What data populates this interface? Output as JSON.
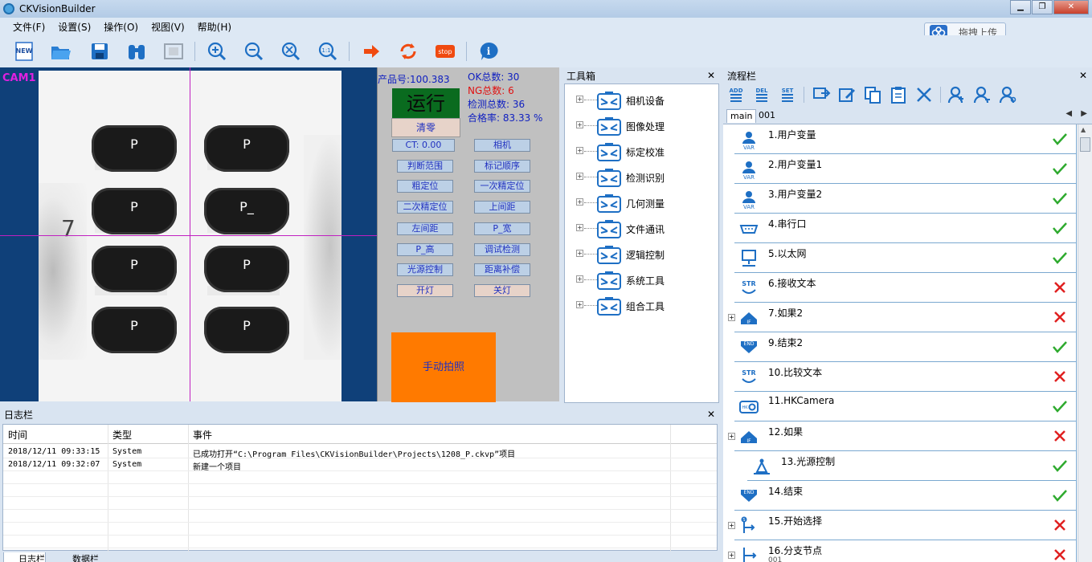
{
  "window": {
    "title": "CKVisionBuilder",
    "minimize": "▁",
    "maximize": "❐",
    "close": "✕"
  },
  "menu": [
    "文件(F)",
    "设置(S)",
    "操作(O)",
    "视图(V)",
    "帮助(H)"
  ],
  "upload_button": "拖拽上传",
  "toolbar": {
    "icons": [
      "new-file-icon",
      "open-folder-icon",
      "save-icon",
      "binoculars-icon",
      "fit-screen-icon",
      "zoom-in-icon",
      "zoom-out-icon",
      "zoom-fit-icon",
      "zoom-actual-icon",
      "run-once-icon",
      "run-loop-icon",
      "stop-icon",
      "help-icon"
    ],
    "new_label": "NEW",
    "stop_label": "stop"
  },
  "camera": {
    "label": "CAM1",
    "side_mark": "7",
    "keycaps": [
      "P",
      "P",
      "P",
      "P_",
      "P",
      "P",
      "P",
      "P"
    ]
  },
  "control": {
    "product_no": "产品号:100.383",
    "ok_total": "OK总数: 30",
    "ng_total": "NG总数: 6",
    "check_total": "检测总数: 36",
    "pass_rate": "合格率: 83.33 %",
    "run_status": "运行",
    "reset": "清零",
    "ct": "CT: 0.00",
    "buttons": [
      "相机",
      "判断范围",
      "标记顺序",
      "粗定位",
      "一次精定位",
      "二次精定位",
      "上间距",
      "左间距",
      "P_宽",
      "P_高",
      "调试检测",
      "光源控制",
      "距离补偿",
      "开灯",
      "关灯"
    ],
    "manual_photo": "手动拍照"
  },
  "toolbox": {
    "title": "工具箱",
    "close": "✕",
    "expander": "+",
    "items": [
      "相机设备",
      "图像处理",
      "标定校准",
      "检测识别",
      "几何测量",
      "文件通讯",
      "逻辑控制",
      "系统工具",
      "组合工具"
    ]
  },
  "flow": {
    "title": "流程栏",
    "close": "✕",
    "toolbar_icons": [
      "add-step-icon",
      "delete-step-icon",
      "set-step-icon",
      "export-icon",
      "edit-icon",
      "copy-icon",
      "paste-icon",
      "cut-icon",
      "user-icon",
      "user-move-icon",
      "user-search-icon"
    ],
    "toolbar_labels": [
      "ADD",
      "DEL",
      "SET"
    ],
    "tabs": [
      "main",
      "001"
    ],
    "nav_prev": "◀",
    "nav_next": "▶",
    "expander": "+",
    "items": [
      {
        "label": "1.用户变量",
        "icon": "var-icon",
        "icon_text": "VAR",
        "status": "ok",
        "indent": false,
        "expander": false
      },
      {
        "label": "2.用户变量1",
        "icon": "var-icon",
        "icon_text": "VAR",
        "status": "ok",
        "indent": false,
        "expander": false
      },
      {
        "label": "3.用户变量2",
        "icon": "var-icon",
        "icon_text": "VAR",
        "status": "ok",
        "indent": false,
        "expander": false
      },
      {
        "label": "4.串行口",
        "icon": "serial-port-icon",
        "icon_text": "",
        "status": "ok",
        "indent": false,
        "expander": false
      },
      {
        "label": "5.以太网",
        "icon": "ethernet-icon",
        "icon_text": "",
        "status": "ok",
        "indent": false,
        "expander": false
      },
      {
        "label": "6.接收文本",
        "icon": "receive-text-icon",
        "icon_text": "STR",
        "status": "fail",
        "indent": false,
        "expander": false
      },
      {
        "label": "7.如果2",
        "icon": "if-icon",
        "icon_text": "IF",
        "status": "fail",
        "indent": false,
        "expander": true
      },
      {
        "label": "9.结束2",
        "icon": "end-icon",
        "icon_text": "END",
        "status": "ok",
        "indent": false,
        "expander": false
      },
      {
        "label": "10.比较文本",
        "icon": "compare-text-icon",
        "icon_text": "STR",
        "status": "fail",
        "indent": false,
        "expander": false
      },
      {
        "label": "11.HKCamera",
        "icon": "camera-icon",
        "icon_text": "HK",
        "status": "ok",
        "indent": false,
        "expander": false
      },
      {
        "label": "12.如果",
        "icon": "if-icon",
        "icon_text": "IF",
        "status": "fail",
        "indent": false,
        "expander": true
      },
      {
        "label": "13.光源控制",
        "icon": "light-control-icon",
        "icon_text": "",
        "status": "ok",
        "indent": true,
        "expander": false
      },
      {
        "label": "14.结束",
        "icon": "end-icon",
        "icon_text": "END",
        "status": "ok",
        "indent": false,
        "expander": false
      },
      {
        "label": "15.开始选择",
        "icon": "branch-start-icon",
        "icon_text": "S",
        "status": "fail",
        "indent": false,
        "expander": true
      },
      {
        "label": "16.分支节点",
        "icon": "branch-node-icon",
        "icon_text": "",
        "status": "fail",
        "indent": false,
        "expander": true,
        "sub": "001"
      }
    ],
    "status_ok": "✔",
    "status_fail": "✕",
    "scroll_up": "▲",
    "scroll_down": "▼"
  },
  "log": {
    "title": "日志栏",
    "close": "✕",
    "columns": [
      "时间",
      "类型",
      "事件"
    ],
    "rows": [
      [
        "2018/12/11 09:33:15",
        "System",
        "已成功打开“C:\\Program Files\\CKVisionBuilder\\Projects\\1208_P.ckvp”项目"
      ],
      [
        "2018/12/11 09:32:07",
        "System",
        "新建一个项目"
      ]
    ],
    "tabs": [
      "日志栏",
      "数据栏"
    ]
  },
  "colors": {
    "camera_bg": "#0f4079",
    "crosshair": "#c020c0",
    "run_box": "#0a6b1f",
    "manual_photo": "#ff7a00",
    "ok_check": "#2eaa2e",
    "fail_x": "#e02020",
    "icon_blue": "#1e6fc4"
  }
}
